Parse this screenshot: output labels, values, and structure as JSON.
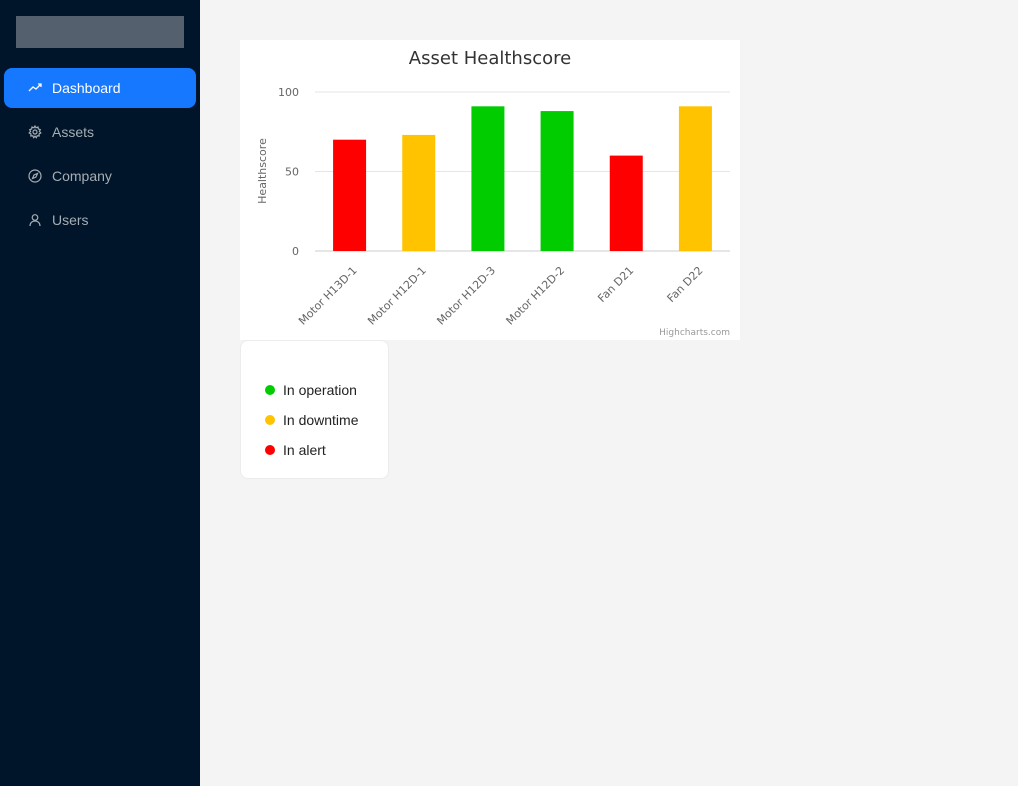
{
  "sidebar": {
    "items": [
      {
        "label": "Dashboard",
        "icon": "trend-line-icon",
        "active": true
      },
      {
        "label": "Assets",
        "icon": "gear-icon",
        "active": false
      },
      {
        "label": "Company",
        "icon": "compass-icon",
        "active": false
      },
      {
        "label": "Users",
        "icon": "user-icon",
        "active": false
      }
    ]
  },
  "chart_data": {
    "type": "bar",
    "title": "Asset Healthscore",
    "xlabel": "",
    "ylabel": "Healthscore",
    "ylim": [
      0,
      100
    ],
    "yticks": [
      0,
      50,
      100
    ],
    "grid": true,
    "categories": [
      "Motor H13D-1",
      "Motor H12D-1",
      "Motor H12D-3",
      "Motor H12D-2",
      "Fan D21",
      "Fan D22"
    ],
    "values": [
      70,
      73,
      91,
      88,
      60,
      91
    ],
    "colors": [
      "#ff0000",
      "#ffc300",
      "#00cc00",
      "#00cc00",
      "#ff0000",
      "#ffc300"
    ],
    "credits": "Highcharts.com"
  },
  "legend": {
    "items": [
      {
        "label": "In operation",
        "color": "#00cc00"
      },
      {
        "label": "In downtime",
        "color": "#ffc300"
      },
      {
        "label": "In alert",
        "color": "#ff0000"
      }
    ]
  }
}
